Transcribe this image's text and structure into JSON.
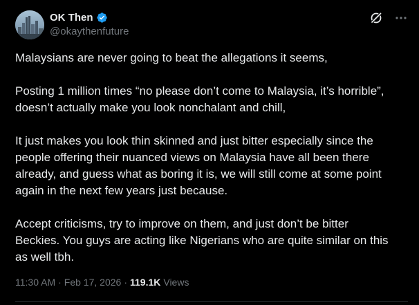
{
  "author": {
    "display_name": "OK Then",
    "handle": "@okaythenfuture",
    "verified": true
  },
  "icons": {
    "avatar": "city-skyline-avatar",
    "verified": "verified-badge-icon",
    "grok": "grok-icon",
    "more": "more-options-icon"
  },
  "colors": {
    "background": "#000000",
    "text": "#e7e9ea",
    "muted": "#71767b",
    "verified_blue": "#1d9bf0"
  },
  "post": {
    "paragraphs": [
      "Malaysians are never going to beat the allegations it seems,",
      "Posting 1 million times “no please don’t come to Malaysia, it’s horrible”,\ndoesn’t actually make you look nonchalant and chill,",
      "It just makes you look thin skinned and just bitter especially since the\npeople offering their nuanced views on Malaysia have all been there\nalready, and guess what as boring it is, we will still come at some point\nagain in the next few years just because.",
      "Accept criticisms, try to improve on them, and just don’t be bitter\nBeckies. You guys are acting like Nigerians who are quite similar on this\nas well tbh."
    ]
  },
  "meta": {
    "time": "11:30 AM",
    "separator": "·",
    "date": "Feb 17, 2026",
    "views_count": "119.1K",
    "views_label": "Views"
  }
}
